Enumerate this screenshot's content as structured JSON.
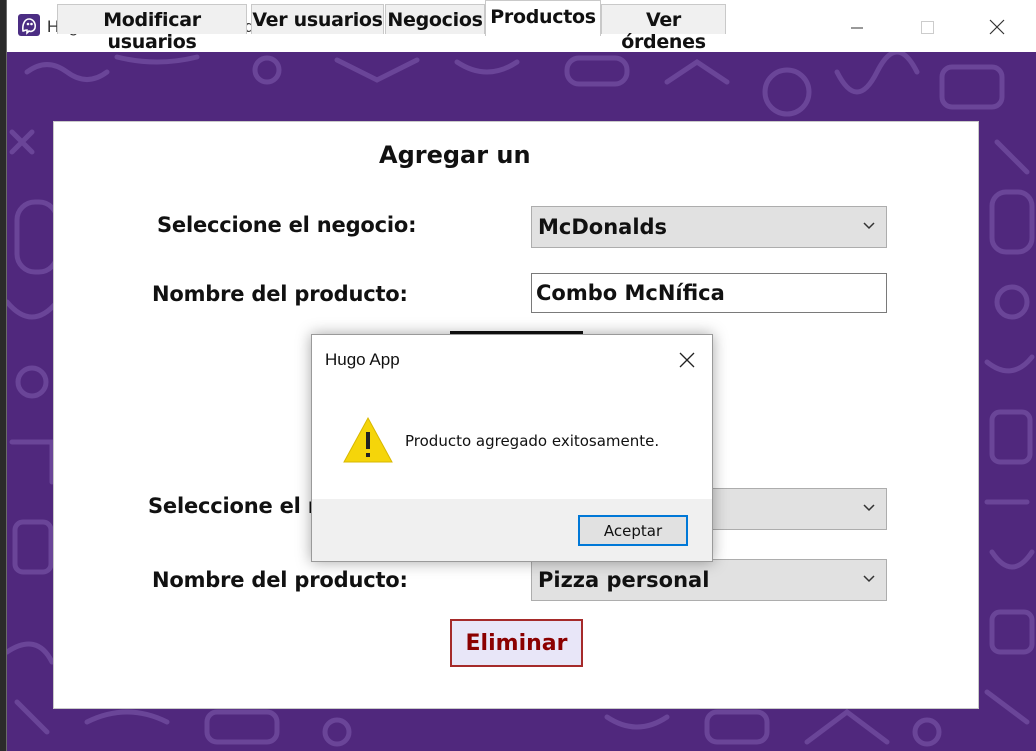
{
  "window": {
    "title": "Hugo - Usuario administrador"
  },
  "tabs": [
    {
      "label": "Modificar usuarios"
    },
    {
      "label": "Ver usuarios"
    },
    {
      "label": "Negocios"
    },
    {
      "label": "Productos"
    },
    {
      "label": "Ver órdenes"
    }
  ],
  "active_tab": "Productos",
  "add_section": {
    "heading": "Agregar un",
    "business_label": "Seleccione el negocio:",
    "business_value": "McDonalds",
    "product_label": "Nombre del producto:",
    "product_value": "Combo McNífica"
  },
  "delete_section": {
    "business_label": "Seleccione el ne",
    "product_label": "Nombre del producto:",
    "product_value": "Pizza personal",
    "delete_button": "Eliminar"
  },
  "dialog": {
    "title": "Hugo App",
    "message": "Producto agregado exitosamente.",
    "ok_button": "Aceptar",
    "icon": "warning-icon"
  },
  "colors": {
    "brand_purple": "#50287d",
    "delete_border": "#a52a2a",
    "delete_text": "#8b0000",
    "focus_blue": "#0078d7",
    "warning_yellow": "#f5d50a"
  }
}
